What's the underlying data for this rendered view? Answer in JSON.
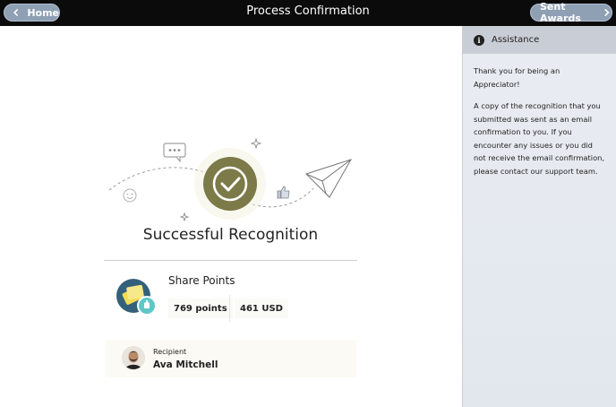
{
  "header": {
    "title": "Process Confirmation",
    "home_label": "Home",
    "sent_awards_label": "Sent Awards"
  },
  "sidebar": {
    "heading": "Assistance",
    "paragraph1": "Thank you for being an Appreciator!",
    "paragraph2": "A copy of the recognition that you submitted was sent as an email confirmation to you. If you encounter any issues or you did not receive the email confirmation, please contact our support team."
  },
  "main": {
    "status_title": "Successful Recognition",
    "award_type": "Share Points",
    "points": "769 points",
    "usd": "461 USD",
    "recipient_label": "Recipient",
    "recipient_name": "Ava Mitchell"
  },
  "icons": {
    "home": "chevron-left-icon",
    "sent_awards": "chevron-right-icon",
    "assistance": "info-icon",
    "status": "checkmark-icon"
  },
  "colors": {
    "topbar": "#0b0b0c",
    "nav_button": "#8fa0b5",
    "success_badge": "#7b7a48",
    "sidebar_header": "#c9cdd6",
    "share_avatar_bg": "#33617b",
    "share_badge": "#5fc7c8"
  }
}
